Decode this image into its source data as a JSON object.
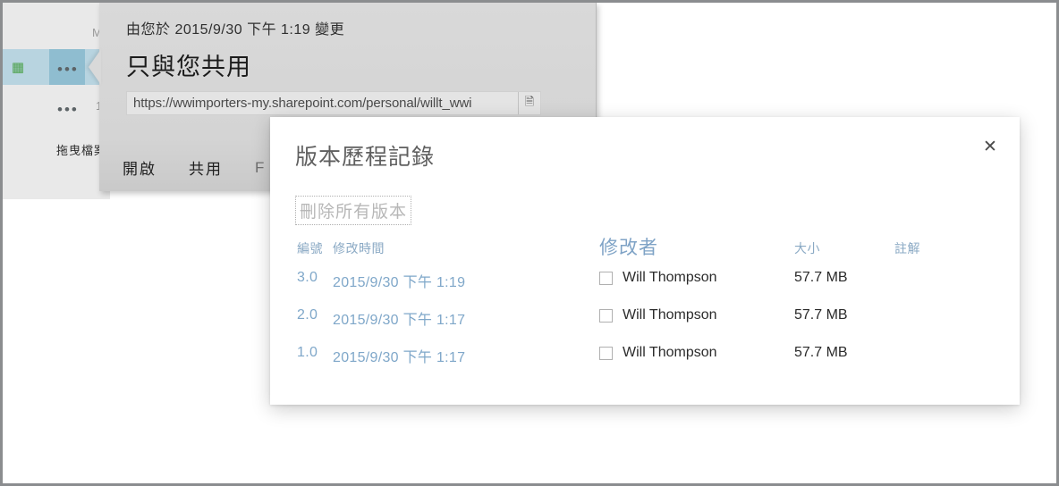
{
  "background": {
    "file_list": {
      "row1_label": "M",
      "row2_label": "1",
      "excel_icon": "excel-file-icon",
      "ellipsis": "•••"
    },
    "drag_files_label": "拖曳檔案"
  },
  "callout": {
    "subtitle": "由您於 2015/9/30 下午 1:19 變更",
    "title": "只與您共用",
    "url_value": "https://wwimporters-my.sharepoint.com/personal/willt_wwi",
    "url_placeholder": "https://",
    "copy_icon": "copy-link-icon",
    "actions": [
      {
        "label": "開啟",
        "name": "open"
      },
      {
        "label": "共用",
        "name": "share"
      },
      {
        "label": "F",
        "name": "more-clipped"
      }
    ]
  },
  "dialog": {
    "title": "版本歷程記錄",
    "close_icon": "✕",
    "delete_all_label": "刪除所有版本",
    "columns": {
      "version": "編號",
      "modified": "修改時間",
      "modified_by": "修改者",
      "size": "大小",
      "comments": "註解"
    },
    "rows": [
      {
        "version": "3.0",
        "modified": "2015/9/30 下午 1:19",
        "modified_by": "Will Thompson",
        "size": "57.7 MB",
        "comments": ""
      },
      {
        "version": "2.0",
        "modified": "2015/9/30 下午 1:17",
        "modified_by": "Will Thompson",
        "size": "57.7 MB",
        "comments": ""
      },
      {
        "version": "1.0",
        "modified": "2015/9/30 下午 1:17",
        "modified_by": "Will Thompson",
        "size": "57.7 MB",
        "comments": ""
      }
    ]
  },
  "colors": {
    "link_blue": "#7fa7c9",
    "header_blue": "#8aa9c4",
    "selected_row": "#b8d4e0",
    "ellipsis_box": "#8fbdd0",
    "callout_bg": "#d9d9d9",
    "excel_green": "#4ea24e"
  }
}
